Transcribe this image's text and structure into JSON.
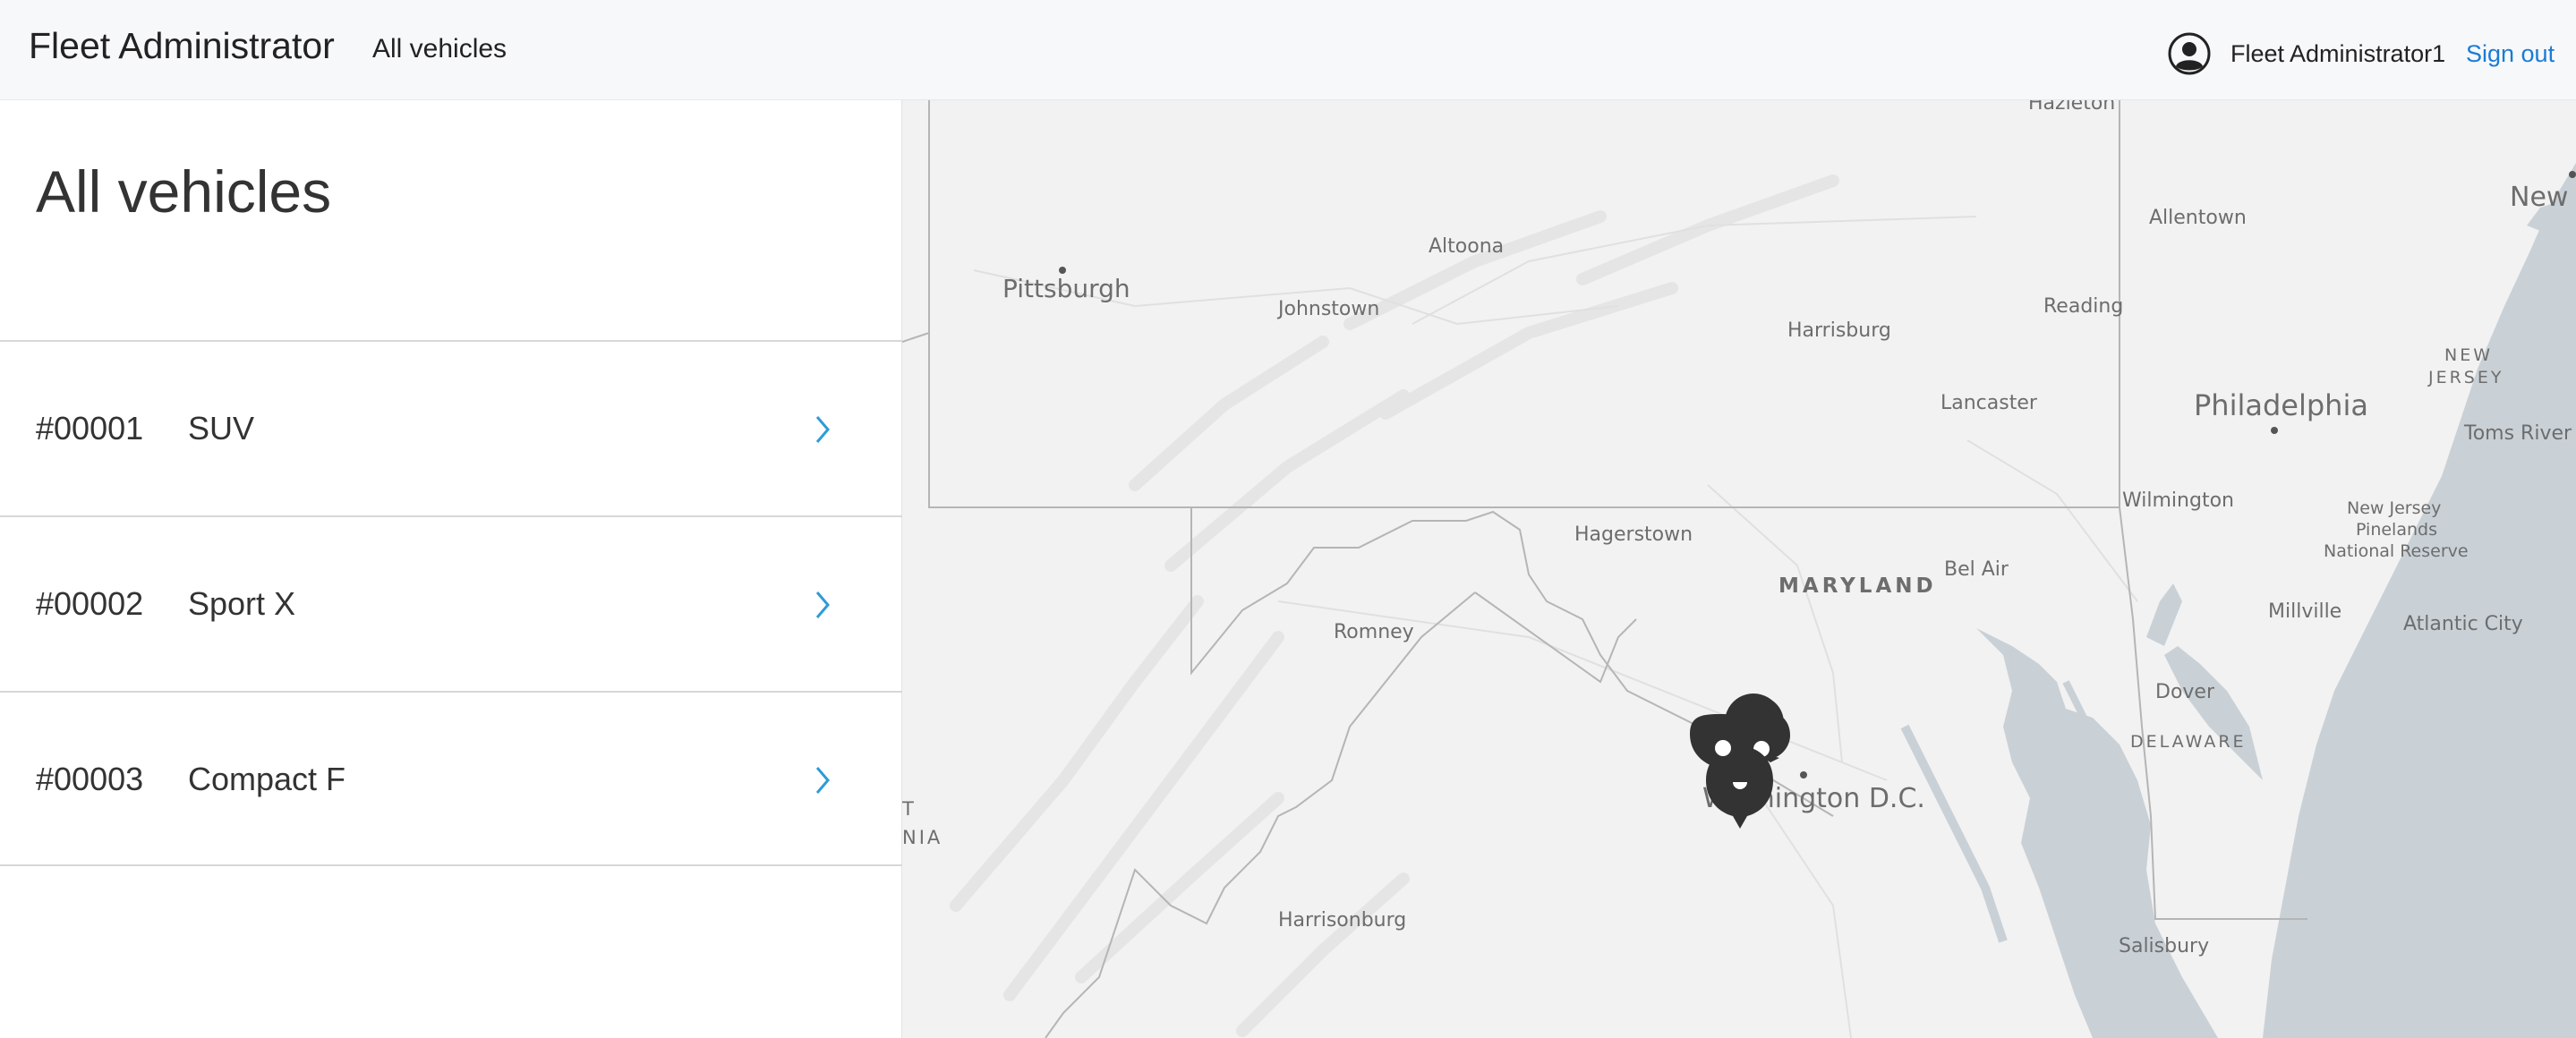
{
  "header": {
    "brand": "Fleet Administrator",
    "nav_link": "All vehicles",
    "user_name": "Fleet Administrator1",
    "signout": "Sign out",
    "user_icon": "user-circle-icon"
  },
  "sidebar": {
    "title": "All vehicles",
    "vehicles": [
      {
        "id": "#00001",
        "name": "SUV"
      },
      {
        "id": "#00002",
        "name": "Sport X"
      },
      {
        "id": "#00003",
        "name": "Compact F"
      }
    ],
    "chevron_icon": "chevron-right-icon"
  },
  "map": {
    "cities": {
      "hazleton": "Hazleton",
      "new_york": "New",
      "allentown": "Allentown",
      "pittsburgh": "Pittsburgh",
      "altoona": "Altoona",
      "johnstown": "Johnstown",
      "reading": "Reading",
      "harrisburg": "Harrisburg",
      "new_jersey_1": "NEW",
      "new_jersey_2": "JERSEY",
      "lancaster": "Lancaster",
      "philadelphia": "Philadelphia",
      "toms_river": "Toms River",
      "wilmington": "Wilmington",
      "nj_pinelands_1": "New Jersey",
      "nj_pinelands_2": "Pinelands",
      "nj_pinelands_3": "National Reserve",
      "hagerstown": "Hagerstown",
      "maryland": "MARYLAND",
      "bel_air": "Bel Air",
      "millville": "Millville",
      "romney": "Romney",
      "atlantic_city": "Atlantic City",
      "dover": "Dover",
      "delaware": "DELAWARE",
      "washington": "Washington D.C.",
      "wv_1": "T",
      "wv_2": "NIA",
      "harrisonburg": "Harrisonburg",
      "salisbury": "Salisbury"
    },
    "marker_color": "#333333",
    "water_color": "#c9d1d7",
    "land_color": "#f2f2f2"
  }
}
